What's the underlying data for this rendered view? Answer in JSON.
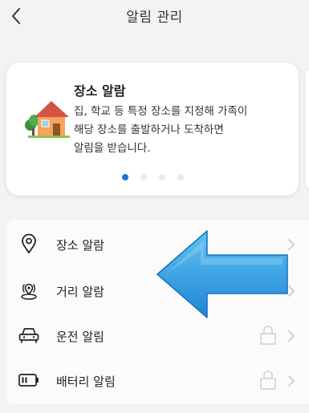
{
  "header": {
    "title": "알림 관리"
  },
  "card": {
    "title": "장소 알람",
    "description": "집, 학교 등 특정 장소를 지정해 가족이\n해당 장소를 출발하거나 도착하면\n알림을 받습니다.",
    "pages": 4,
    "active_page": 1
  },
  "menu": {
    "items": [
      {
        "label": "장소 알람",
        "icon": "location-pin-icon",
        "locked": false
      },
      {
        "label": "거리 알람",
        "icon": "distance-icon",
        "locked": false
      },
      {
        "label": "운전 알림",
        "icon": "car-icon",
        "locked": true
      },
      {
        "label": "배터리 알림",
        "icon": "battery-icon",
        "locked": true
      }
    ]
  },
  "colors": {
    "accent": "#1e73d8",
    "arrow": "#2f9fe3",
    "background": "#f3f3f6"
  }
}
